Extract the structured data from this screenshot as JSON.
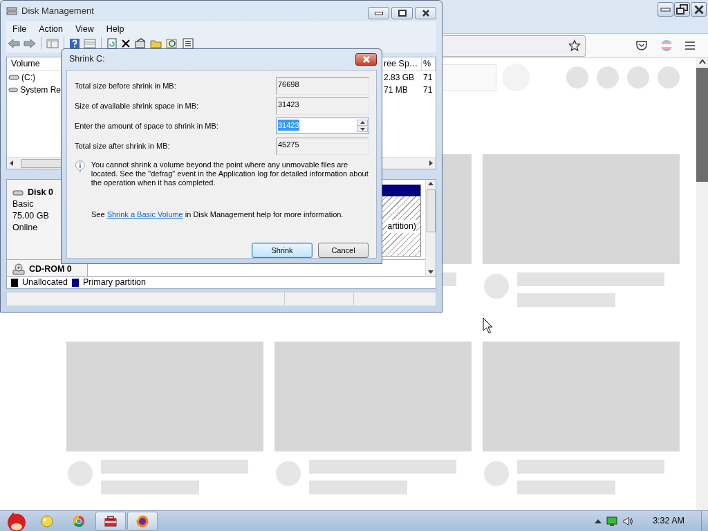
{
  "disk_management": {
    "title": "Disk Management",
    "menu": [
      "File",
      "Action",
      "View",
      "Help"
    ],
    "volume_columns": [
      "Volume",
      "ree Sp…",
      "%"
    ],
    "volumes": [
      {
        "name": "(C:)",
        "free": "2.83 GB",
        "percent": "71"
      },
      {
        "name": "System Re",
        "free": "71 MB",
        "percent": "71"
      }
    ],
    "disk": {
      "name": "Disk 0",
      "details": [
        "Basic",
        "75.00 GB",
        "Online"
      ],
      "partition_label": "artition)"
    },
    "cdrom": {
      "name": "CD-ROM 0"
    },
    "legend": [
      {
        "label": "Unallocated",
        "color": "#000000"
      },
      {
        "label": "Primary partition",
        "color": "#000080"
      }
    ]
  },
  "dialog": {
    "title": "Shrink C:",
    "fields": [
      {
        "label": "Total size before shrink in MB:",
        "value": "76698",
        "kind": "readonly"
      },
      {
        "label": "Size of available shrink space in MB:",
        "value": "31423",
        "kind": "readonly"
      },
      {
        "label": "Enter the amount of space to shrink in MB:",
        "value": "31423",
        "kind": "spin",
        "selected": true
      },
      {
        "label": "Total size after shrink in MB:",
        "value": "45275",
        "kind": "readonly"
      }
    ],
    "info": "You cannot shrink a volume beyond the point where any unmovable files are located. See the \"defrag\" event in the Application log for detailed information about the operation when it has completed.",
    "help": {
      "before": "See",
      "link": "Shrink a Basic Volume",
      "after": "in Disk Management help for more information."
    },
    "buttons": [
      {
        "label": "Shrink",
        "default": true
      },
      {
        "label": "Cancel",
        "default": false
      }
    ]
  },
  "taskbar": {
    "apps": [
      {
        "running": false
      },
      {
        "running": false
      },
      {
        "running": true
      },
      {
        "running": true
      }
    ],
    "time": "3:32 AM"
  }
}
